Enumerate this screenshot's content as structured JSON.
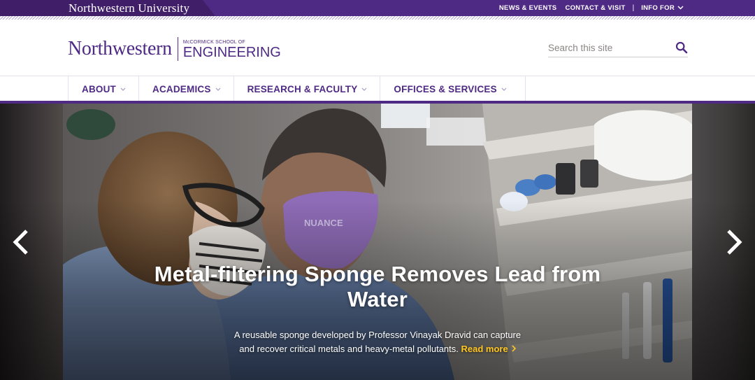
{
  "utility": {
    "university": "Northwestern University",
    "links": [
      {
        "label": "NEWS & EVENTS"
      },
      {
        "label": "CONTACT & VISIT"
      },
      {
        "label": "INFO FOR"
      }
    ],
    "separator": "|"
  },
  "header": {
    "logo_main": "Northwestern",
    "logo_school_top": "McCORMICK SCHOOL OF",
    "logo_school_main": "ENGINEERING",
    "search": {
      "placeholder": "Search this site",
      "value": ""
    }
  },
  "nav": {
    "items": [
      {
        "label": "ABOUT"
      },
      {
        "label": "ACADEMICS"
      },
      {
        "label": "RESEARCH & FACULTY"
      },
      {
        "label": "OFFICES & SERVICES"
      }
    ]
  },
  "hero": {
    "title": "Metal-filtering Sponge Removes Lead from Water",
    "description_line1": "A reusable sponge developed by Professor Vinayak Dravid can capture",
    "description_line2": "and recover critical metals and heavy-metal pollutants.",
    "read_more": "Read more",
    "mask_text": "NUANCE"
  },
  "colors": {
    "brand_purple": "#4e2a84",
    "dark_purple": "#401f68",
    "accent_gold": "#ffc520"
  }
}
